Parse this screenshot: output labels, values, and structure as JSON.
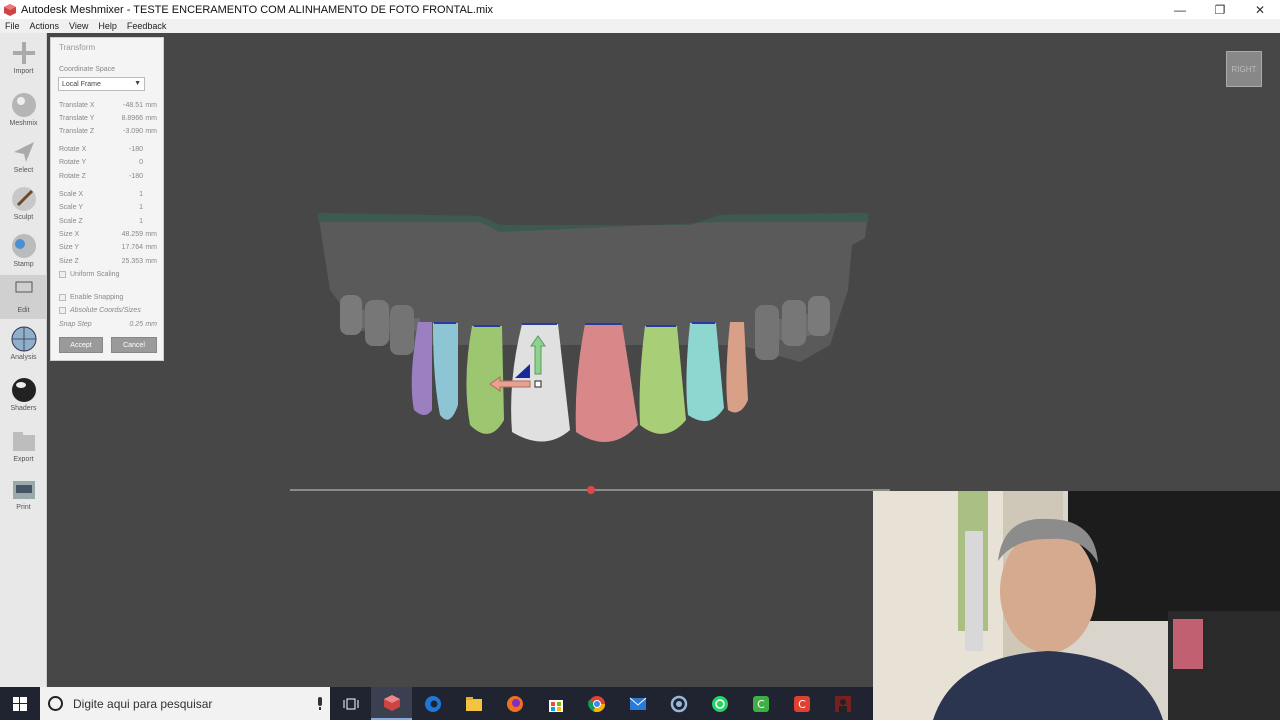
{
  "window": {
    "title": "Autodesk Meshmixer - TESTE ENCERAMENTO COM ALINHAMENTO DE FOTO FRONTAL.mix",
    "minimize": "—",
    "maximize": "❐",
    "close": "✕"
  },
  "menu": [
    "File",
    "Actions",
    "View",
    "Help",
    "Feedback"
  ],
  "toolbar": [
    {
      "label": "Import",
      "icon": "plus-icon"
    },
    {
      "label": "Meshmix",
      "icon": "meshmix-ball-icon"
    },
    {
      "label": "Select",
      "icon": "select-arrow-icon"
    },
    {
      "label": "Sculpt",
      "icon": "sculpt-brush-icon"
    },
    {
      "label": "Stamp",
      "icon": "stamp-icon"
    },
    {
      "label": "Edit",
      "icon": "edit-icon"
    },
    {
      "label": "Analysis",
      "icon": "analysis-globe-icon"
    },
    {
      "label": "Shaders",
      "icon": "shaders-sphere-icon"
    },
    {
      "label": "Export",
      "icon": "export-folder-icon"
    },
    {
      "label": "Print",
      "icon": "print-icon"
    }
  ],
  "panel": {
    "title": "Transform",
    "coord_label": "Coordinate Space",
    "coord_value": "Local Frame",
    "fields": [
      {
        "k": "Translate X",
        "v": "-48.51",
        "u": "mm"
      },
      {
        "k": "Translate Y",
        "v": "8.8966",
        "u": "mm"
      },
      {
        "k": "Translate Z",
        "v": "-3.090",
        "u": "mm"
      },
      {
        "k": "Rotate X",
        "v": "-180",
        "u": ""
      },
      {
        "k": "Rotate Y",
        "v": "0",
        "u": ""
      },
      {
        "k": "Rotate Z",
        "v": "-180",
        "u": ""
      },
      {
        "k": "Scale X",
        "v": "1",
        "u": ""
      },
      {
        "k": "Scale Y",
        "v": "1",
        "u": ""
      },
      {
        "k": "Scale Z",
        "v": "1",
        "u": ""
      },
      {
        "k": "Size X",
        "v": "48.259",
        "u": "mm"
      },
      {
        "k": "Size Y",
        "v": "17.764",
        "u": "mm"
      },
      {
        "k": "Size Z",
        "v": "25.353",
        "u": "mm"
      }
    ],
    "uniform_scaling": "Uniform Scaling",
    "enable_snapping": "Enable Snapping",
    "absolute_coords": "Absolute Coords/Sizes",
    "snap_step_label": "Snap Step",
    "snap_step_value": "0.25",
    "snap_step_unit": "mm",
    "accept": "Accept",
    "cancel": "Cancel"
  },
  "viewcube": "RIGHT",
  "taskbar": {
    "search_placeholder": "Digite aqui para pesquisar",
    "apps": [
      "task-view-icon",
      "meshmixer-icon",
      "edge-icon",
      "file-explorer-icon",
      "firefox-icon",
      "store-icon",
      "chrome-icon",
      "mail-icon",
      "app-swirl-icon",
      "whatsapp-icon",
      "camtasia-green-icon",
      "camtasia-red-icon",
      "webcam-app-icon"
    ]
  }
}
